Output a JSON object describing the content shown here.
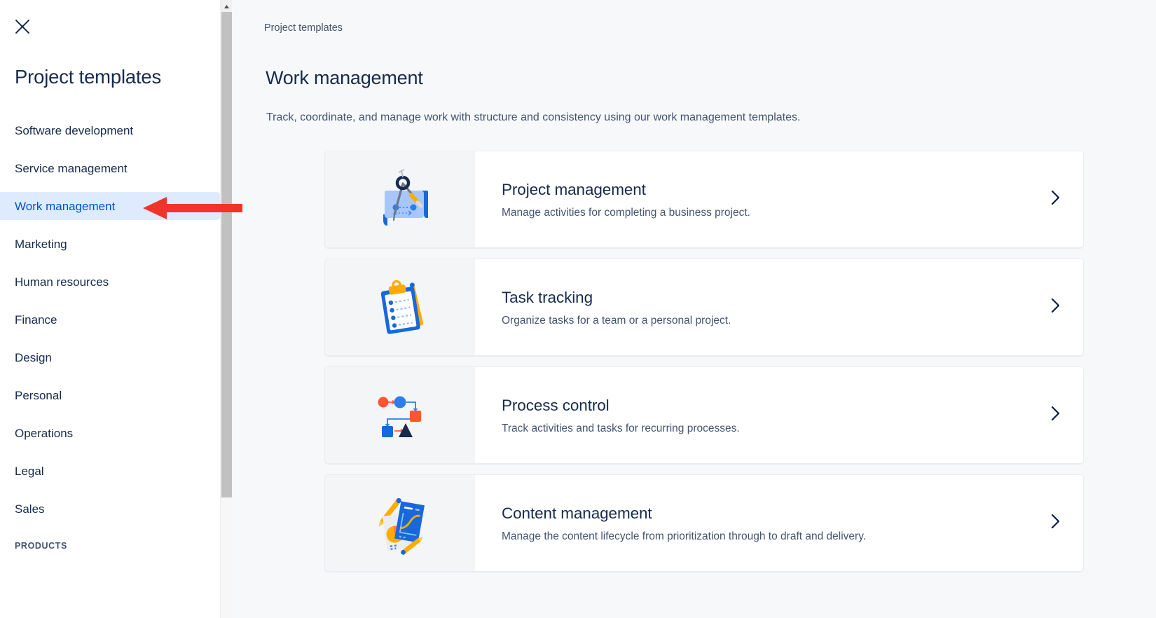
{
  "sidebar": {
    "close_icon": "close-icon",
    "title": "Project templates",
    "items": [
      {
        "label": "Software development",
        "selected": false
      },
      {
        "label": "Service management",
        "selected": false
      },
      {
        "label": "Work management",
        "selected": true
      },
      {
        "label": "Marketing",
        "selected": false
      },
      {
        "label": "Human resources",
        "selected": false
      },
      {
        "label": "Finance",
        "selected": false
      },
      {
        "label": "Design",
        "selected": false
      },
      {
        "label": "Personal",
        "selected": false
      },
      {
        "label": "Operations",
        "selected": false
      },
      {
        "label": "Legal",
        "selected": false
      },
      {
        "label": "Sales",
        "selected": false
      }
    ],
    "section_label": "PRODUCTS",
    "scrollbar": {
      "up_arrow_icon": "chevron-up-icon"
    }
  },
  "main": {
    "breadcrumb": "Project templates",
    "title": "Work management",
    "description": "Track, coordinate, and manage work with structure and consistency using our work management templates.",
    "cards": [
      {
        "title": "Project management",
        "description": "Manage activities for completing a business project.",
        "icon": "blueprint-compass-icon",
        "chevron": "chevron-right-icon"
      },
      {
        "title": "Task tracking",
        "description": "Organize tasks for a team or a personal project.",
        "icon": "clipboard-checklist-icon",
        "chevron": "chevron-right-icon"
      },
      {
        "title": "Process control",
        "description": "Track activities and tasks for recurring processes.",
        "icon": "flowchart-icon",
        "chevron": "chevron-right-icon"
      },
      {
        "title": "Content management",
        "description": "Manage the content lifecycle from prioritization through to draft and delivery.",
        "icon": "documents-charts-icon",
        "chevron": "chevron-right-icon"
      }
    ]
  },
  "annotation": {
    "arrow": "red-left-arrow",
    "color": "#f0342c"
  },
  "colors": {
    "accent": "#0052cc",
    "selected_bg": "#deebff",
    "text": "#172b4d",
    "muted_text": "#44546f",
    "page_bg": "#f7f8fa",
    "icon_pane_bg": "#f4f5f7"
  }
}
